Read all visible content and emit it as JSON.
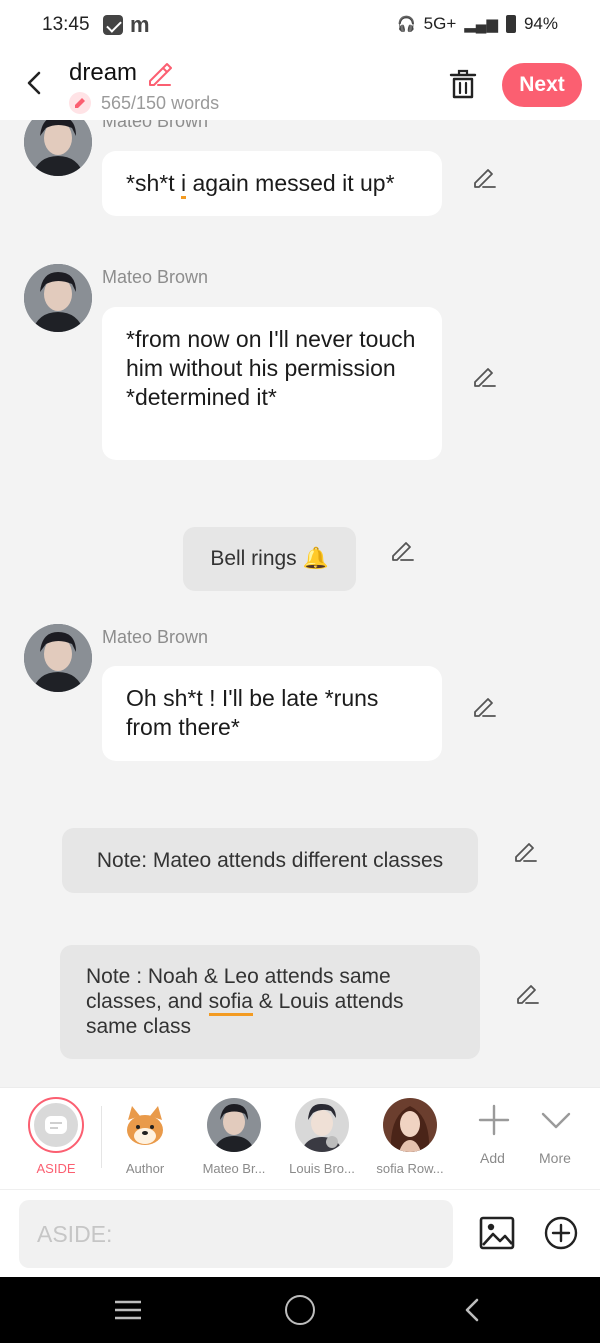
{
  "status_bar": {
    "time": "13:45",
    "notification_letter": "m",
    "network": "5G+",
    "battery": "94%"
  },
  "header": {
    "title": "dream",
    "word_count": "565/150 words",
    "next_label": "Next"
  },
  "feed": {
    "items": [
      {
        "type": "dialogue",
        "speaker": "Mateo Brown",
        "text_before_typo": "*sh*t ",
        "typo": "i",
        "text_after_typo": " again messed it up*"
      },
      {
        "type": "dialogue",
        "speaker": "Mateo Brown",
        "text": "*from now on I'll never touch him without his permission *determined it*"
      },
      {
        "type": "aside",
        "text": "Bell rings 🔔"
      },
      {
        "type": "dialogue",
        "speaker": "Mateo Brown",
        "text": "Oh sh*t ! I'll be late *runs from there*"
      },
      {
        "type": "note",
        "text": "Note: Mateo attends different classes"
      },
      {
        "type": "note",
        "text_before_typo": "Note : Noah & Leo attends same classes, and ",
        "typo": "sofia",
        "text_after_typo": " & Louis attends same class"
      }
    ]
  },
  "characters": {
    "items": [
      {
        "label": "ASIDE",
        "active": true
      },
      {
        "label": "Author"
      },
      {
        "label": "Mateo Br..."
      },
      {
        "label": "Louis Bro..."
      },
      {
        "label": "sofia Row..."
      }
    ],
    "add_label": "Add",
    "more_label": "More"
  },
  "composer": {
    "placeholder": "ASIDE:"
  },
  "colors": {
    "accent": "#fb5f71",
    "bubble_white": "#ffffff",
    "note_gray": "#e6e6e6",
    "typo_underline": "#f39b22"
  },
  "icons": [
    "back-arrow-icon",
    "pencil-icon",
    "trash-icon",
    "image-icon",
    "plus-circle-icon",
    "plus-icon",
    "chevron-down-icon",
    "menu-icon",
    "home-icon"
  ]
}
